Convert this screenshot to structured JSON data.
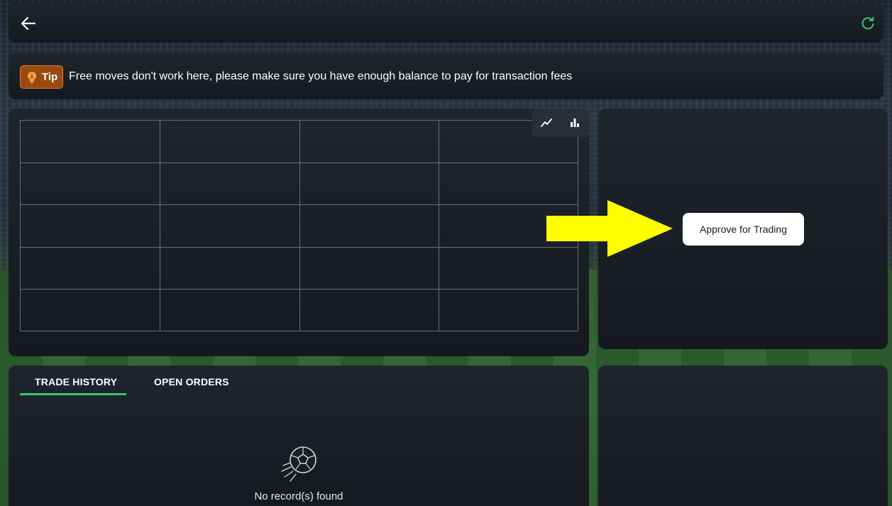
{
  "header": {
    "back_icon": "arrow-left-icon",
    "refresh_icon": "refresh-icon",
    "refresh_color": "#2ecc71"
  },
  "tip": {
    "badge_label": "Tip",
    "badge_icon": "lightbulb-icon",
    "badge_color": "#9a4a10",
    "message": "Free moves don't work here, please make sure you have enough balance to pay for transaction fees"
  },
  "chart": {
    "toggle_icons": [
      "line-chart-icon",
      "bar-chart-icon"
    ]
  },
  "trade_panel": {
    "approve_label": "Approve for Trading",
    "arrow_color": "#ffff00"
  },
  "history": {
    "tabs": [
      {
        "label": "TRADE HISTORY",
        "active": true
      },
      {
        "label": "OPEN ORDERS",
        "active": false
      }
    ],
    "accent_color": "#2ecc71",
    "empty_icon": "soccer-ball-icon",
    "empty_text": "No record(s) found"
  }
}
